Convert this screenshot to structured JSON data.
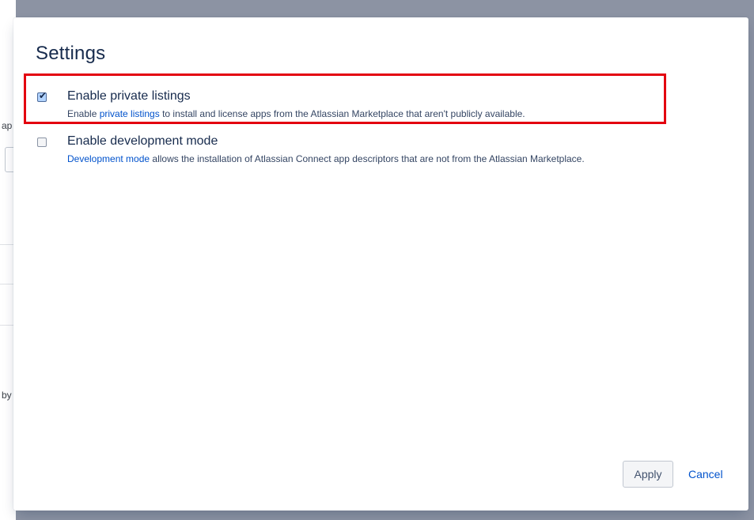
{
  "background_page": {
    "fragment_1": "ap",
    "fragment_2": "by"
  },
  "dialog": {
    "title": "Settings",
    "options": [
      {
        "label": "Enable private listings",
        "checked": true,
        "desc_before": "Enable ",
        "link_text": "private listings",
        "desc_after": " to install and license apps from the Atlassian Marketplace that aren't publicly available."
      },
      {
        "label": "Enable development mode",
        "checked": false,
        "desc_before": "",
        "link_text": "Development mode",
        "desc_after": " allows the installation of Atlassian Connect app descriptors that are not from the Atlassian Marketplace."
      }
    ],
    "apply_label": "Apply",
    "cancel_label": "Cancel"
  },
  "colors": {
    "overlay": "#8c93a3",
    "link": "#0052cc",
    "highlight": "#e3000f",
    "text": "#172b4d"
  }
}
